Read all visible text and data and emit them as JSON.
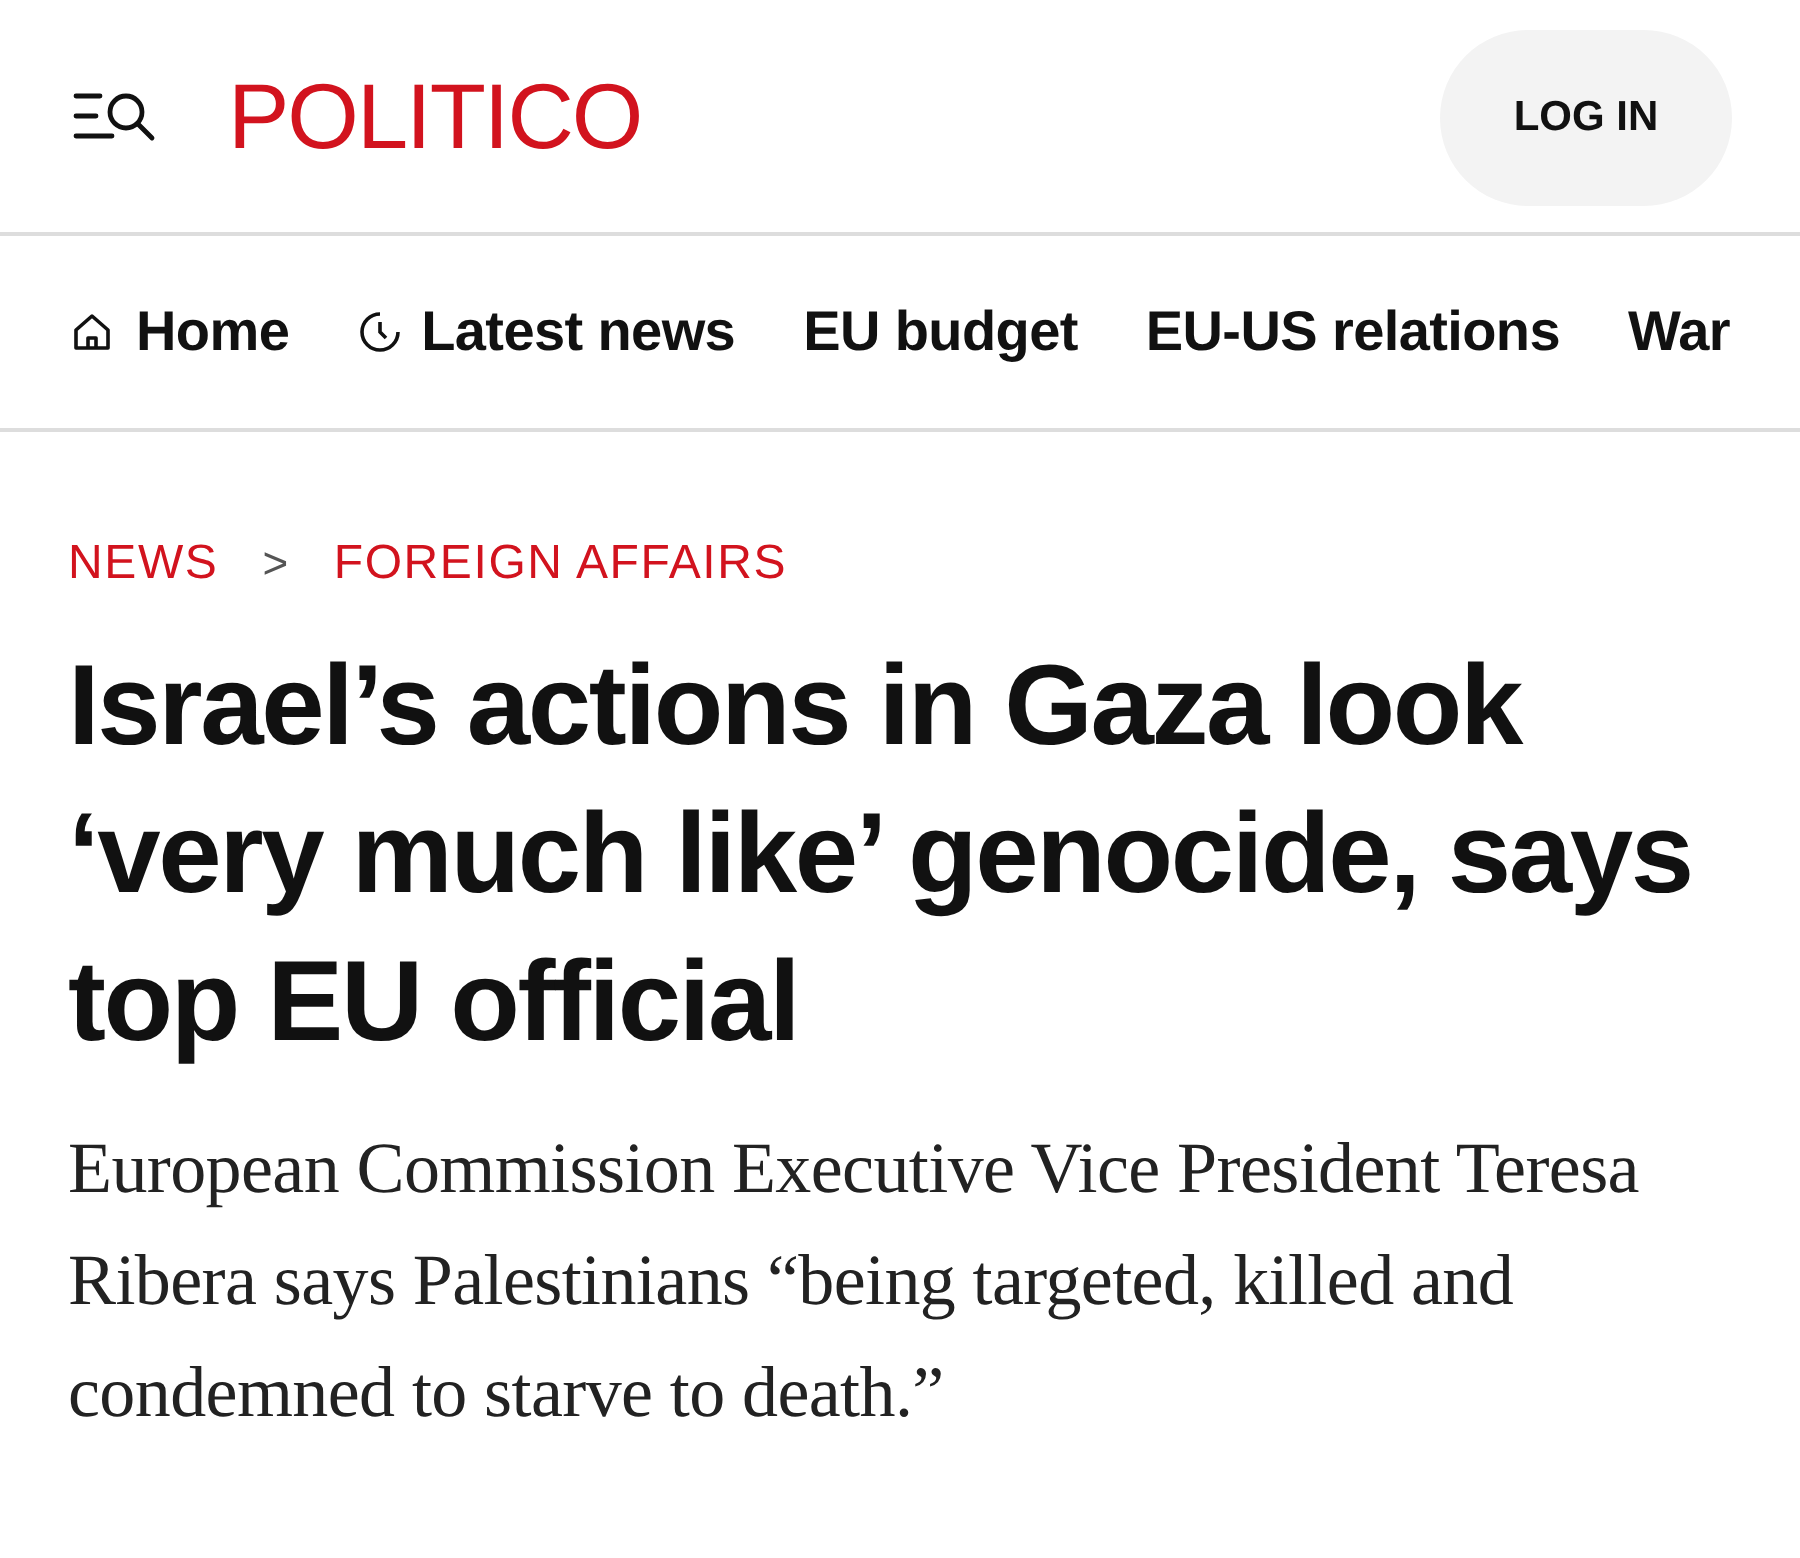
{
  "header": {
    "logo": "POLITICO",
    "login_button": "LOG IN"
  },
  "nav": {
    "items": [
      {
        "label": "Home",
        "kind": "home"
      },
      {
        "label": "Latest news",
        "kind": "clock"
      },
      {
        "label": "EU budget",
        "kind": "plain"
      },
      {
        "label": "EU-US relations",
        "kind": "plain"
      },
      {
        "label": "War",
        "kind": "plain"
      }
    ]
  },
  "breadcrumb": [
    {
      "label": "NEWS"
    },
    {
      "label": "FOREIGN AFFAIRS"
    }
  ],
  "breadcrumb_separator": ">",
  "headline": "Israel’s actions in Gaza look ‘very much like’ genocide, says top EU official",
  "deck": "European Commission Executive Vice President Teresa Ribera says Palestinians “being targeted, killed and condemned to starve to death.”"
}
